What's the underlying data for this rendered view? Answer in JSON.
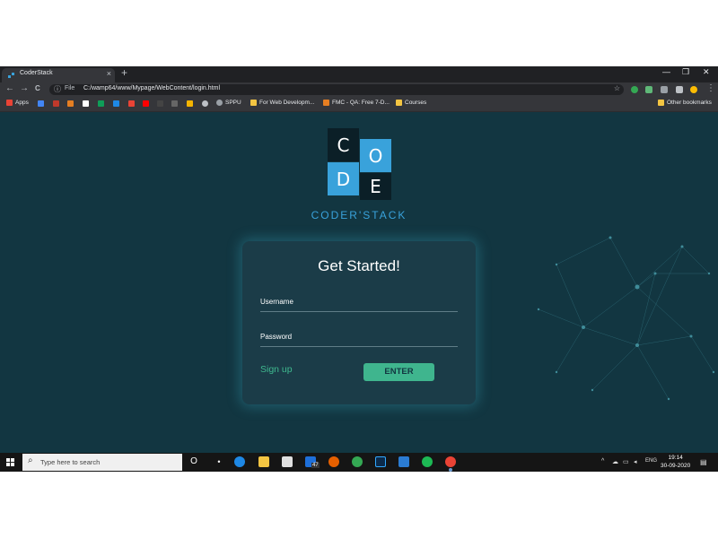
{
  "browser": {
    "tab_title": "CoderStack",
    "tab_close": "×",
    "new_tab": "+",
    "window_controls": {
      "minimize": "—",
      "restore": "❐",
      "close": "✕"
    },
    "nav": {
      "back": "←",
      "forward": "→",
      "reload": "C"
    },
    "omnibox": {
      "info_icon": "ⓘ",
      "label": "File",
      "url": "C:/wamp64/www/Mypage/WebContent/login.html",
      "star": "☆"
    },
    "menu": "⋮",
    "bookmarks": [
      {
        "label": "Apps",
        "icon": "apps-icon"
      },
      {
        "label": "SPPU",
        "icon": "globe-icon"
      },
      {
        "label": "For Web Developm...",
        "icon": "folder-icon"
      },
      {
        "label": "FMC - QA: Free 7-D...",
        "icon": "fmc-icon"
      },
      {
        "label": "Courses",
        "icon": "folder-icon"
      }
    ],
    "other_bookmarks": "Other bookmarks"
  },
  "page": {
    "logo_letters": [
      "C",
      "O",
      "D",
      "E"
    ],
    "brand": "CODER'STACK",
    "card_title": "Get Started!",
    "username_label": "Username",
    "password_label": "Password",
    "signup_link": "Sign up",
    "enter_button": "ENTER"
  },
  "taskbar": {
    "search_placeholder": "Type here to search",
    "task_view": "O",
    "mail_badge": "47",
    "tray": {
      "chevron": "^",
      "language": "ENG",
      "time": "19:14",
      "date": "30-09-2020"
    }
  },
  "colors": {
    "page_bg": "#123641",
    "card_bg": "#1b3c48",
    "accent": "#3fb58e",
    "brand_blue": "#39a2db"
  }
}
